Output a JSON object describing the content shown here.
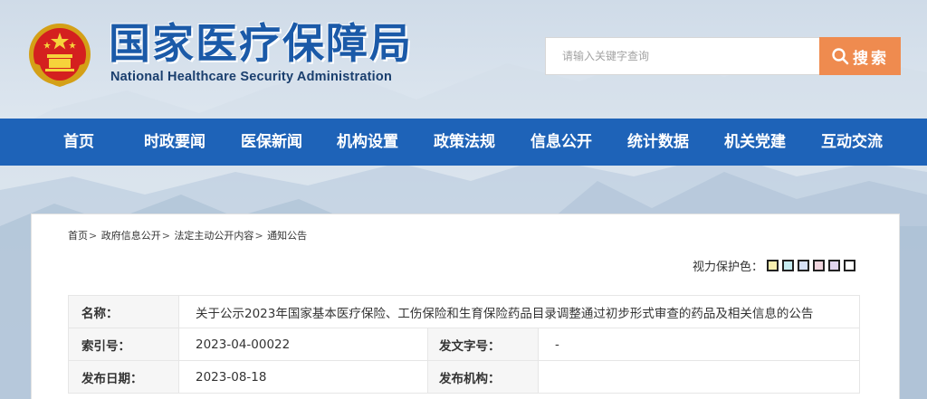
{
  "header": {
    "title_cn": "国家医疗保障局",
    "title_en": "National Healthcare Security Administration",
    "emblem_icon": "national-emblem-icon"
  },
  "search": {
    "placeholder": "请输入关键字查询",
    "button_label": "搜索",
    "button_color": "#ef8b4f"
  },
  "nav": {
    "color": "#1e63b8",
    "items": [
      {
        "label": "首页"
      },
      {
        "label": "时政要闻"
      },
      {
        "label": "医保新闻"
      },
      {
        "label": "机构设置"
      },
      {
        "label": "政策法规"
      },
      {
        "label": "信息公开"
      },
      {
        "label": "统计数据"
      },
      {
        "label": "机关党建"
      },
      {
        "label": "互动交流"
      }
    ]
  },
  "breadcrumb": {
    "items": [
      "首页",
      "政府信息公开",
      "法定主动公开内容",
      "通知公告"
    ],
    "separator": ">"
  },
  "vision": {
    "label": "视力保护色：",
    "swatches": [
      "#f7eeb0",
      "#c6ecf1",
      "#d7e1f6",
      "#f0d5de",
      "#e2d5ef",
      "#ffffff"
    ]
  },
  "info": {
    "name_label": "名称：",
    "name_value": "关于公示2023年国家基本医疗保险、工伤保险和生育保险药品目录调整通过初步形式审查的药品及相关信息的公告",
    "index_label": "索引号：",
    "index_value": "2023-04-00022",
    "docno_label": "发文字号：",
    "docno_value": "-",
    "date_label": "发布日期：",
    "date_value": "2023-08-18",
    "org_label": "发布机构：",
    "org_value": ""
  }
}
